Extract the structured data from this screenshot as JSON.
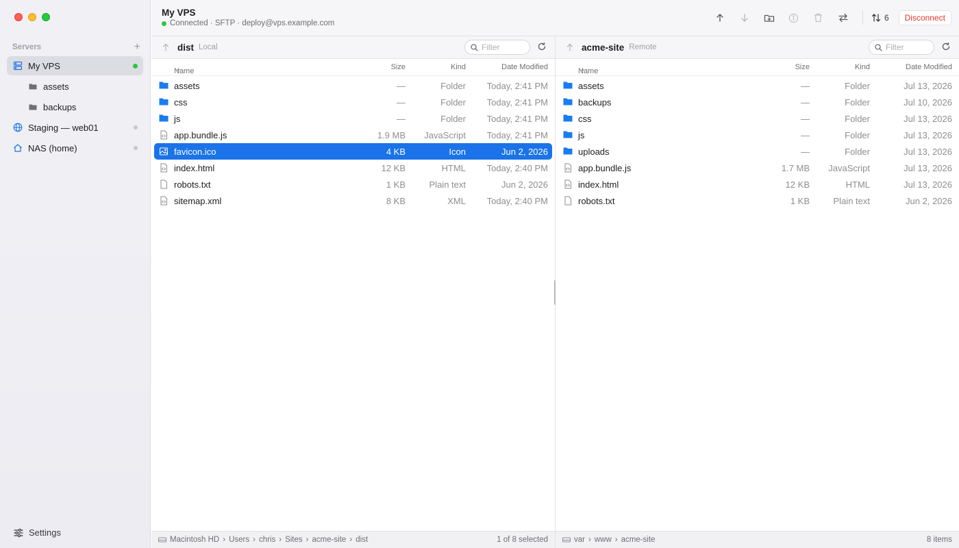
{
  "sidebar": {
    "section_label": "Servers",
    "servers": [
      {
        "label": "My VPS",
        "icon": "server-icon",
        "status": "connected",
        "active": true
      },
      {
        "label": "assets",
        "icon": "folder-icon",
        "sub": true
      },
      {
        "label": "backups",
        "icon": "folder-icon",
        "sub": true
      },
      {
        "label": "Staging — web01",
        "icon": "globe-icon",
        "status": "idle"
      },
      {
        "label": "NAS (home)",
        "icon": "home-icon",
        "status": "idle"
      }
    ],
    "settings_label": "Settings"
  },
  "toolbar": {
    "title": "My VPS",
    "subtitle": "Connected · SFTP · deploy@vps.example.com",
    "transfers_count": "6",
    "disconnect_label": "Disconnect"
  },
  "columns": {
    "name": "Name",
    "size": "Size",
    "kind": "Kind",
    "date": "Date Modified"
  },
  "local": {
    "name": "dist",
    "type": "Local",
    "filter_placeholder": "Filter",
    "files": [
      {
        "name": "assets",
        "size": "—",
        "kind": "Folder",
        "date": "Today, 2:41 PM",
        "icon": "folder-icon"
      },
      {
        "name": "css",
        "size": "—",
        "kind": "Folder",
        "date": "Today, 2:41 PM",
        "icon": "folder-icon"
      },
      {
        "name": "js",
        "size": "—",
        "kind": "Folder",
        "date": "Today, 2:41 PM",
        "icon": "folder-icon"
      },
      {
        "name": "app.bundle.js",
        "size": "1.9 MB",
        "kind": "JavaScript",
        "date": "Today, 2:41 PM",
        "icon": "code-file-icon"
      },
      {
        "name": "favicon.ico",
        "size": "4 KB",
        "kind": "Icon",
        "date": "Jun 2, 2026",
        "icon": "image-file-icon",
        "selected": true
      },
      {
        "name": "index.html",
        "size": "12 KB",
        "kind": "HTML",
        "date": "Today, 2:40 PM",
        "icon": "code-file-icon"
      },
      {
        "name": "robots.txt",
        "size": "1 KB",
        "kind": "Plain text",
        "date": "Jun 2, 2026",
        "icon": "text-file-icon"
      },
      {
        "name": "sitemap.xml",
        "size": "8 KB",
        "kind": "XML",
        "date": "Today, 2:40 PM",
        "icon": "code-file-icon"
      }
    ],
    "path": [
      "Macintosh HD",
      "Users",
      "chris",
      "Sites",
      "acme-site",
      "dist"
    ],
    "status": "1 of 8 selected"
  },
  "remote": {
    "name": "acme-site",
    "type": "Remote",
    "filter_placeholder": "Filter",
    "files": [
      {
        "name": "assets",
        "size": "—",
        "kind": "Folder",
        "date": "Jul 13, 2026",
        "icon": "folder-icon"
      },
      {
        "name": "backups",
        "size": "—",
        "kind": "Folder",
        "date": "Jul 10, 2026",
        "icon": "folder-icon"
      },
      {
        "name": "css",
        "size": "—",
        "kind": "Folder",
        "date": "Jul 13, 2026",
        "icon": "folder-icon"
      },
      {
        "name": "js",
        "size": "—",
        "kind": "Folder",
        "date": "Jul 13, 2026",
        "icon": "folder-icon"
      },
      {
        "name": "uploads",
        "size": "—",
        "kind": "Folder",
        "date": "Jul 13, 2026",
        "icon": "folder-icon"
      },
      {
        "name": "app.bundle.js",
        "size": "1.7 MB",
        "kind": "JavaScript",
        "date": "Jul 13, 2026",
        "icon": "code-file-icon"
      },
      {
        "name": "index.html",
        "size": "12 KB",
        "kind": "HTML",
        "date": "Jul 13, 2026",
        "icon": "code-file-icon"
      },
      {
        "name": "robots.txt",
        "size": "1 KB",
        "kind": "Plain text",
        "date": "Jun 2, 2026",
        "icon": "text-file-icon"
      }
    ],
    "path": [
      "var",
      "www",
      "acme-site"
    ],
    "status": "8 items"
  },
  "colors": {
    "accent": "#1a73e8",
    "folder": "#1a7cf0",
    "connected": "#28c840",
    "danger": "#e5352b"
  }
}
